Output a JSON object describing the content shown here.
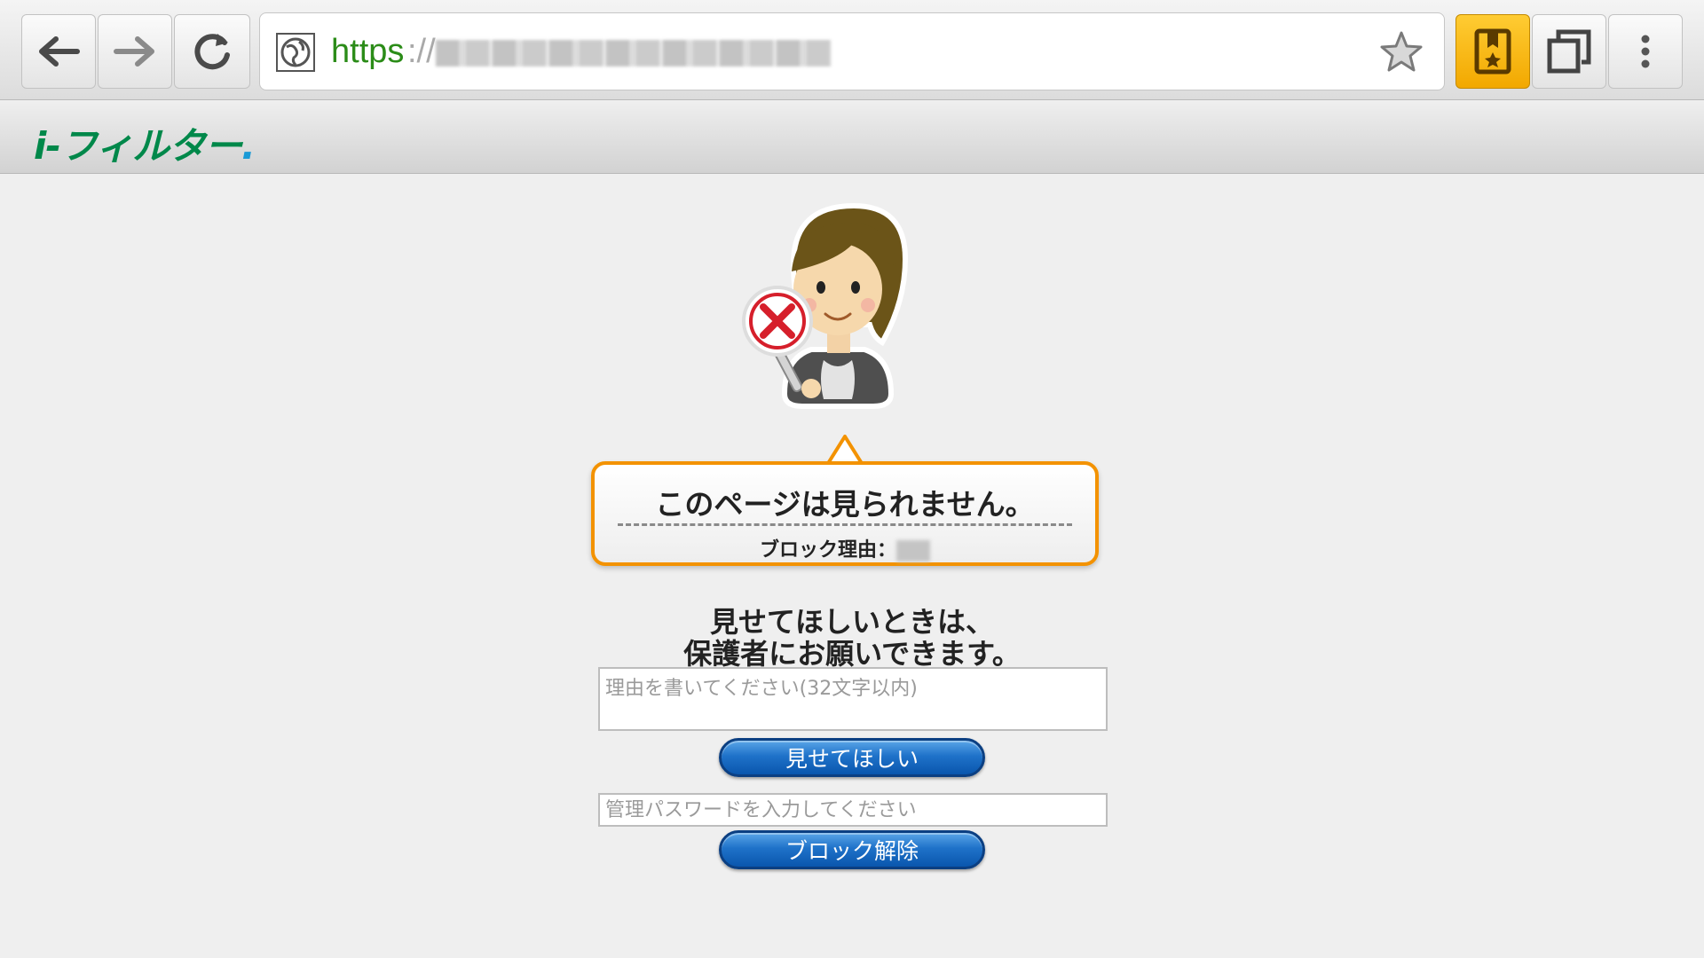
{
  "browser": {
    "url_scheme": "https",
    "url_separator": "://",
    "icons": {
      "back": "back-arrow-icon",
      "forward": "forward-arrow-icon",
      "reload": "reload-icon",
      "site": "globe-icon",
      "bookmark_star": "star-icon",
      "bookmarks": "bookmark-icon",
      "tabs": "tabs-icon",
      "menu": "overflow-menu-icon"
    },
    "colors": {
      "url_scheme": "#2b8c18",
      "bookmarks_active": "#f2a800"
    }
  },
  "site": {
    "logo_text": "i-フィルター",
    "logo_dot": ".",
    "brand_color": "#00884a"
  },
  "block": {
    "title": "このページは見られません。",
    "reason_label": "ブロック理由：",
    "mascot_icon": "blocked-mascot-icon",
    "accent_color": "#f39200"
  },
  "request": {
    "line1": "見せてほしいときは、",
    "line2": "保護者にお願いできます。",
    "reason_placeholder": "理由を書いてください(32文字以内)",
    "submit_label": "見せてほしい"
  },
  "unblock": {
    "password_placeholder": "管理パスワードを入力してください",
    "button_label": "ブロック解除",
    "button_color": "#1f72c9"
  }
}
